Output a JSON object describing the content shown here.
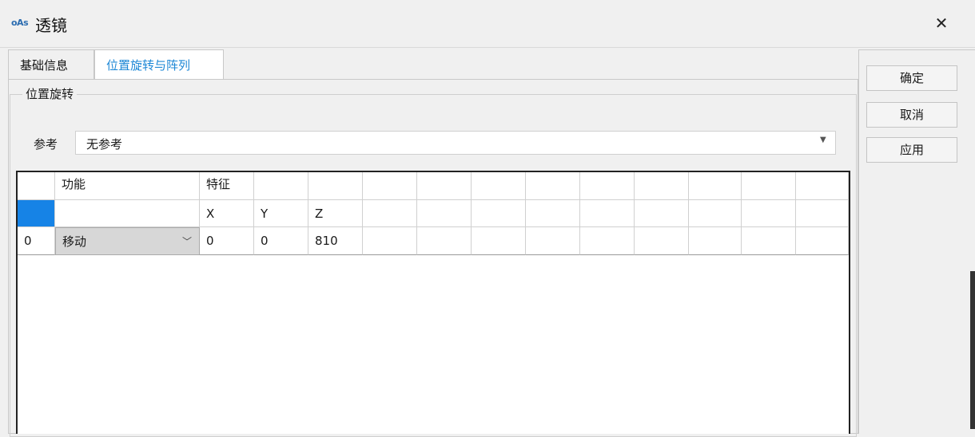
{
  "window": {
    "title": "透镜",
    "logo": "oAs"
  },
  "tabs": [
    {
      "label": "基础信息",
      "active": false
    },
    {
      "label": "位置旋转与阵列",
      "active": true
    }
  ],
  "group": {
    "legend": "位置旋转"
  },
  "reference": {
    "label": "参考",
    "value": "无参考"
  },
  "grid": {
    "header_row1": [
      "",
      "功能",
      "特征",
      "",
      "",
      "",
      "",
      "",
      "",
      "",
      "",
      "",
      "",
      "",
      ""
    ],
    "header_row2": [
      "",
      "",
      "X",
      "Y",
      "Z",
      "",
      "",
      "",
      "",
      "",
      "",
      "",
      "",
      "",
      ""
    ],
    "rows": [
      {
        "cells": [
          "0",
          "移动",
          "0",
          "0",
          "810",
          "",
          "",
          "",
          "",
          "",
          "",
          "",
          "",
          "",
          ""
        ]
      }
    ]
  },
  "buttons": {
    "ok": "确定",
    "cancel": "取消",
    "apply": "应用"
  },
  "colors": {
    "accent": "#1e88d6",
    "selection": "#1683e6"
  },
  "icons": {
    "close": "close-icon",
    "dropdown": "chevron-down-icon"
  }
}
